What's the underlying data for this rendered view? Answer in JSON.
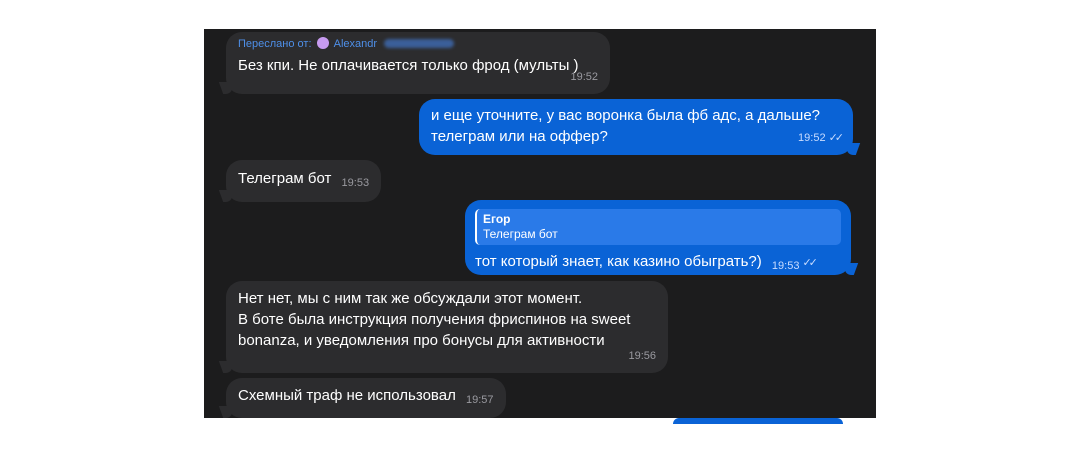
{
  "messages": [
    {
      "forwarded_label": "Переслано от:",
      "forwarded_name": "Alexandr",
      "text": "Без кпи. Не оплачивается только фрод (мульты )",
      "time": "19:52"
    },
    {
      "text_line1": "и еще уточните, у вас воронка была фб адс, а дальше?",
      "text_line2": "телеграм или на оффер?",
      "time": "19:52"
    },
    {
      "text": "Телеграм бот",
      "time": "19:53"
    },
    {
      "quote_name": "Егор",
      "quote_text": "Телеграм бот",
      "text": "тот который знает, как казино обыграть?)",
      "time": "19:53"
    },
    {
      "text_line1": "Нет нет, мы с ним так же обсуждали этот момент.",
      "text_line2": "В боте была инструкция получения фриспинов на sweet",
      "text_line3": "bonanza, и уведомления про бонусы для активности",
      "time": "19:56"
    },
    {
      "text": "Схемный траф не использовал",
      "time": "19:57"
    }
  ],
  "read_icon": "double-check-icon",
  "colors": {
    "chat_background": "#1c1c1d",
    "incoming_bubble": "#2c2c2e",
    "outgoing_bubble": "#0a63d6",
    "forward_accent": "#4e8fe8"
  }
}
